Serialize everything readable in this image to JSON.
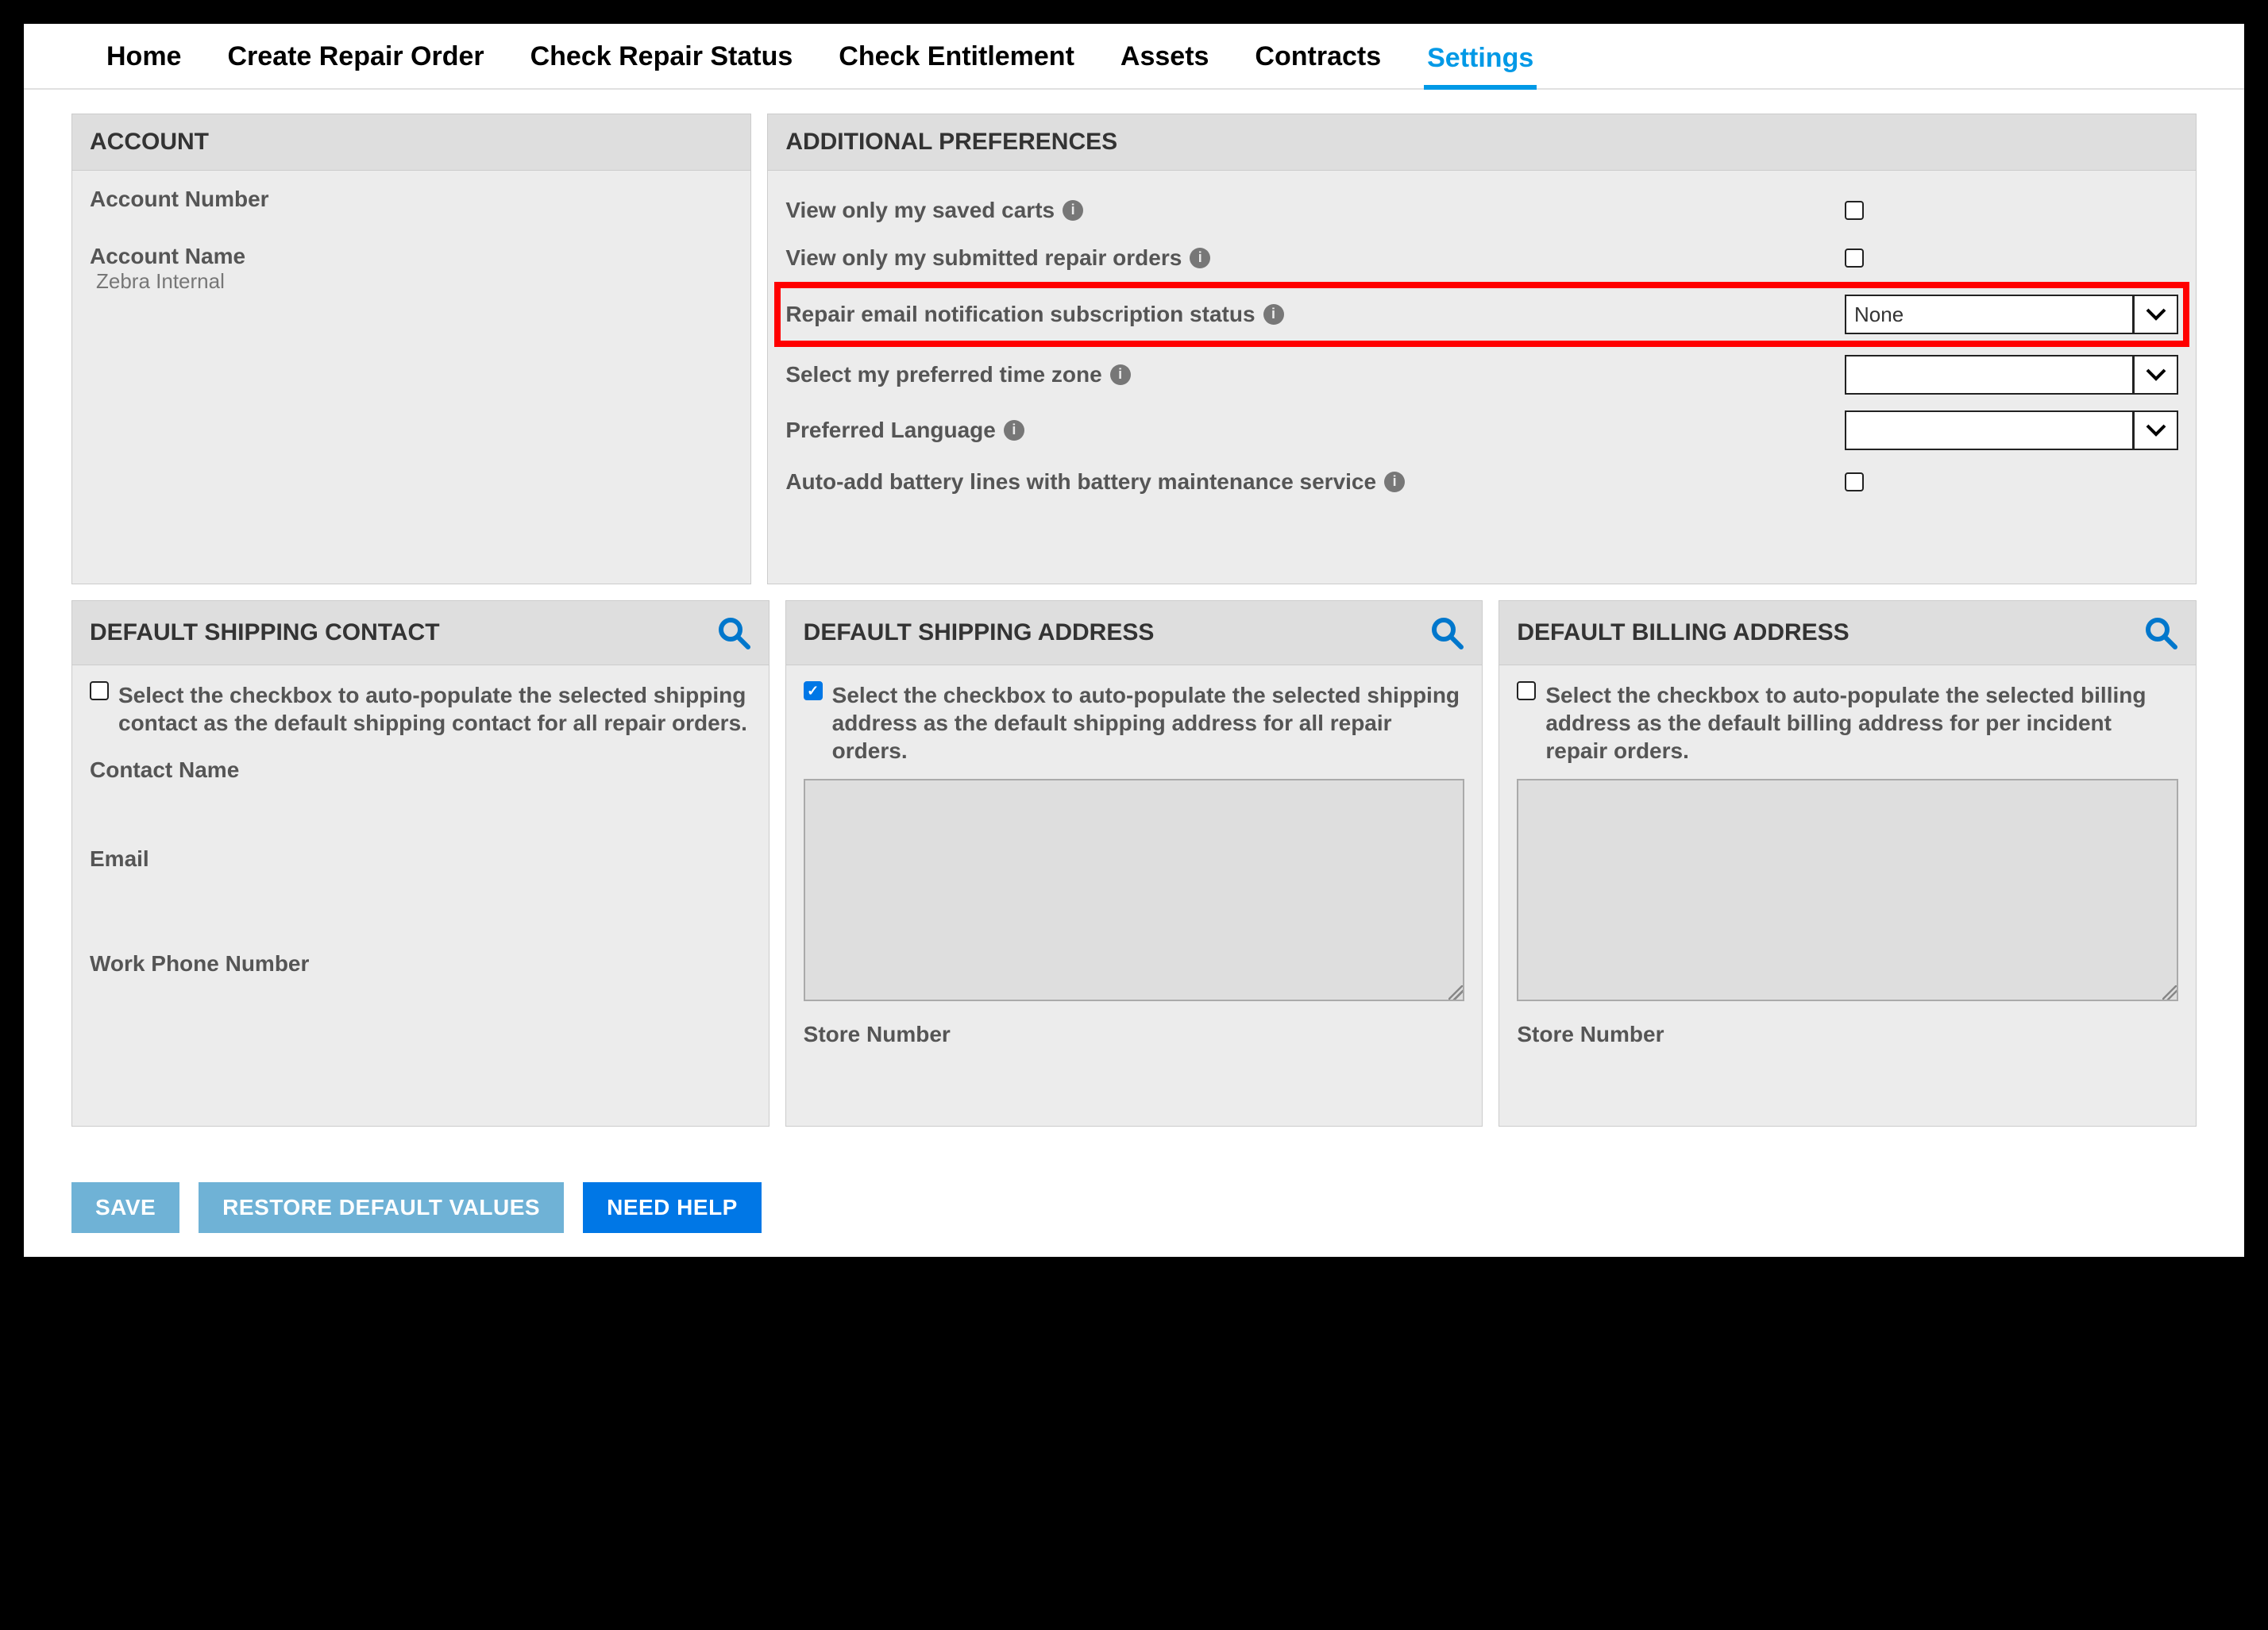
{
  "nav": {
    "items": [
      {
        "label": "Home",
        "active": false
      },
      {
        "label": "Create Repair Order",
        "active": false
      },
      {
        "label": "Check Repair Status",
        "active": false
      },
      {
        "label": "Check Entitlement",
        "active": false
      },
      {
        "label": "Assets",
        "active": false
      },
      {
        "label": "Contracts",
        "active": false
      },
      {
        "label": "Settings",
        "active": true
      }
    ]
  },
  "account": {
    "title": "ACCOUNT",
    "number_label": "Account Number",
    "number_value": "",
    "name_label": "Account Name",
    "name_value": "Zebra Internal"
  },
  "prefs": {
    "title": "ADDITIONAL PREFERENCES",
    "rows": {
      "saved_carts": {
        "label": "View only my saved carts",
        "checked": false
      },
      "submitted_orders": {
        "label": "View only my submitted repair orders",
        "checked": false
      },
      "repair_email": {
        "label": "Repair email notification subscription status",
        "value": "None"
      },
      "timezone": {
        "label": "Select my preferred time zone",
        "value": ""
      },
      "language": {
        "label": "Preferred Language",
        "value": ""
      },
      "auto_battery": {
        "label": "Auto-add battery lines with battery maintenance service",
        "checked": false
      }
    }
  },
  "shipping_contact": {
    "title": "DEFAULT SHIPPING CONTACT",
    "checkbox_checked": false,
    "checkbox_text": "Select the checkbox to auto-populate the selected shipping contact as the default shipping contact for all repair orders.",
    "fields": {
      "contact_name": "Contact Name",
      "email": "Email",
      "work_phone": "Work Phone Number"
    }
  },
  "shipping_address": {
    "title": "DEFAULT SHIPPING ADDRESS",
    "checkbox_checked": true,
    "checkbox_text": "Select the checkbox to auto-populate the selected shipping address as the default shipping address for all repair orders.",
    "address_value": "",
    "store_number_label": "Store Number"
  },
  "billing_address": {
    "title": "DEFAULT BILLING ADDRESS",
    "checkbox_checked": false,
    "checkbox_text": "Select the checkbox to auto-populate the selected billing address as the default billing address for per incident repair orders.",
    "address_value": "",
    "store_number_label": "Store Number"
  },
  "buttons": {
    "save": "SAVE",
    "restore": "RESTORE DEFAULT VALUES",
    "help": "NEED HELP"
  }
}
